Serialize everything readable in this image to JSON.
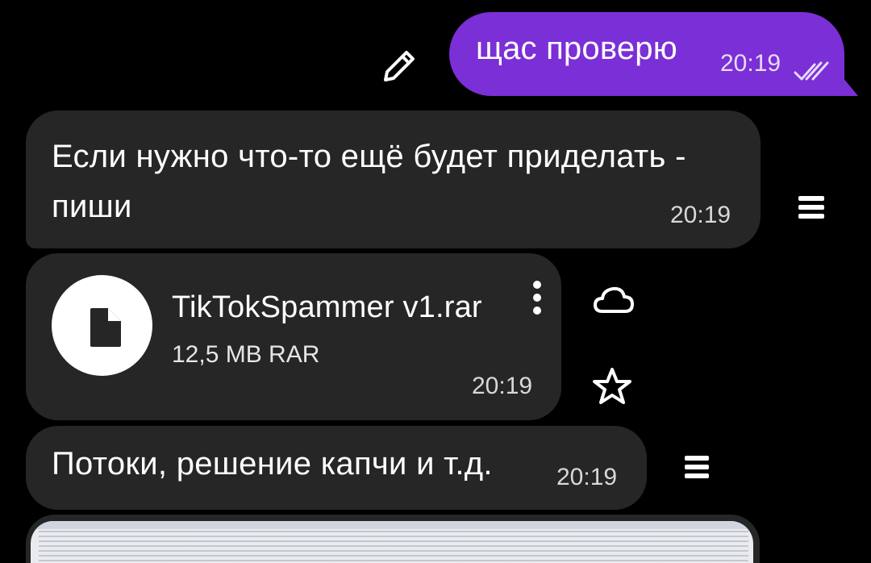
{
  "messages": {
    "outgoing_1": {
      "text": "щас проверю",
      "time": "20:19",
      "status_icon": "double-check-icon"
    },
    "incoming_1": {
      "text": "Если нужно что-то ещё будет приделать - пиши",
      "time": "20:19"
    },
    "file_message": {
      "file_name": "TikTokSpammer v1.rar",
      "file_meta": "12,5 MB RAR",
      "time": "20:19"
    },
    "incoming_2": {
      "text": "Потоки, решение капчи и т.д.",
      "time": "20:19"
    }
  },
  "colors": {
    "background": "#000000",
    "outgoing_bubble": "#7b2fd6",
    "incoming_bubble": "#262626"
  },
  "icons": [
    "edit-icon",
    "double-check-icon",
    "menu-icon",
    "file-icon",
    "more-vertical-icon",
    "cloud-icon",
    "star-icon"
  ]
}
